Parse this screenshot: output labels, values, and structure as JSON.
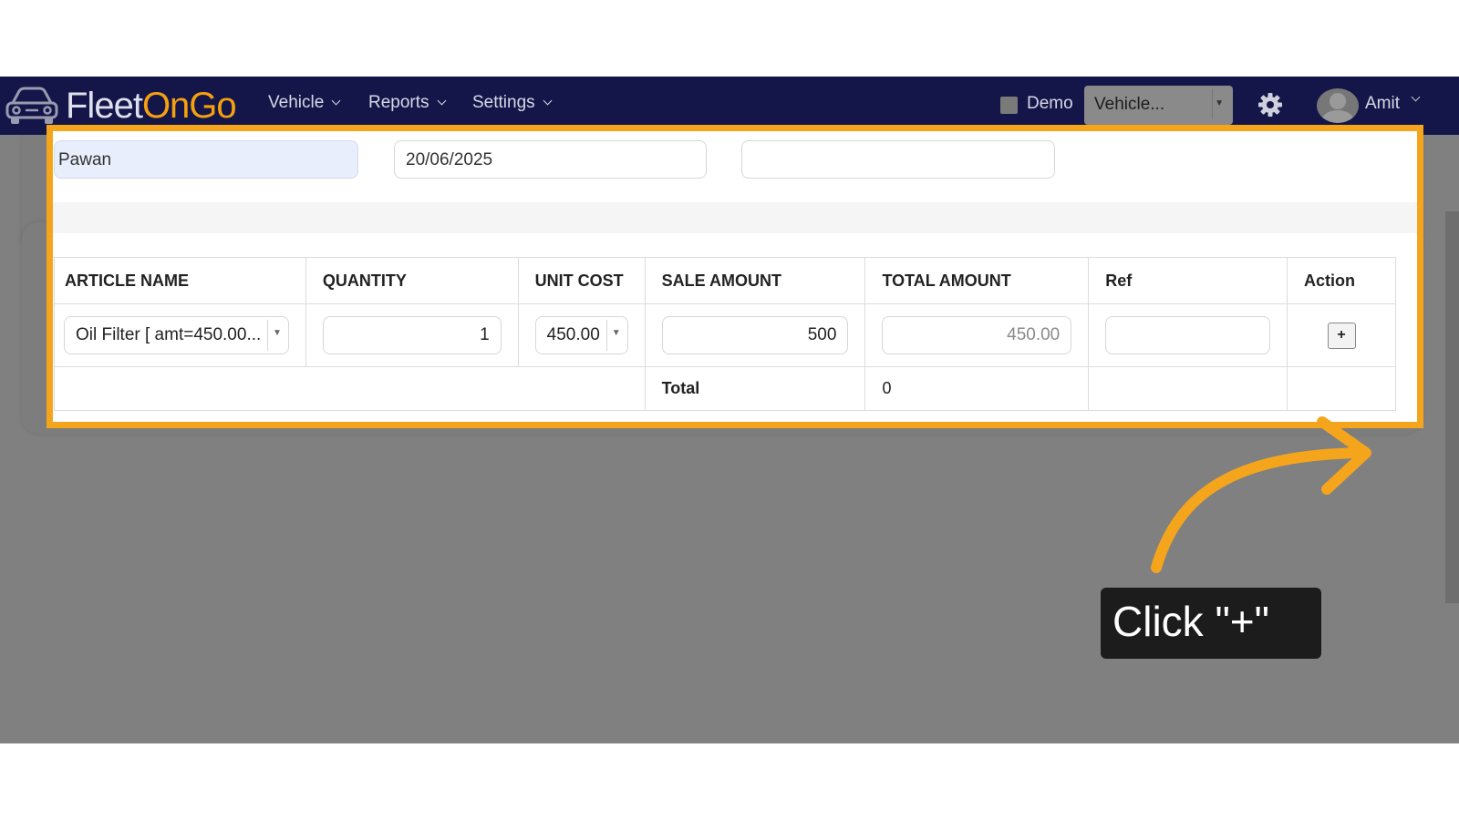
{
  "navbar": {
    "logo_part1": "Fleet",
    "logo_part2": "OnGo",
    "menus": [
      {
        "label": "Vehicle"
      },
      {
        "label": "Reports"
      },
      {
        "label": "Settings"
      }
    ],
    "demo_label": "Demo",
    "vehicle_select": "Vehicle...",
    "user_name": "Amit",
    "brand_color": "#f5a00e",
    "bar_color": "#14164a"
  },
  "form": {
    "name_value": "Pawan",
    "date_value": "20/06/2025",
    "extra_value": ""
  },
  "table": {
    "headers": [
      "ARTICLE NAME",
      "QUANTITY",
      "UNIT COST",
      "SALE AMOUNT",
      "TOTAL AMOUNT",
      "Ref",
      "Action"
    ],
    "row": {
      "article": "Oil Filter [ amt=450.00...",
      "quantity": "1",
      "unit_cost": "450.00",
      "sale_amount": "500",
      "total_amount": "450.00",
      "ref": "",
      "action": "+"
    },
    "footer": {
      "total_label": "Total",
      "total_value": "0"
    }
  },
  "callout": {
    "text": "Click \"+\"",
    "highlight_color": "#f5a51c"
  }
}
